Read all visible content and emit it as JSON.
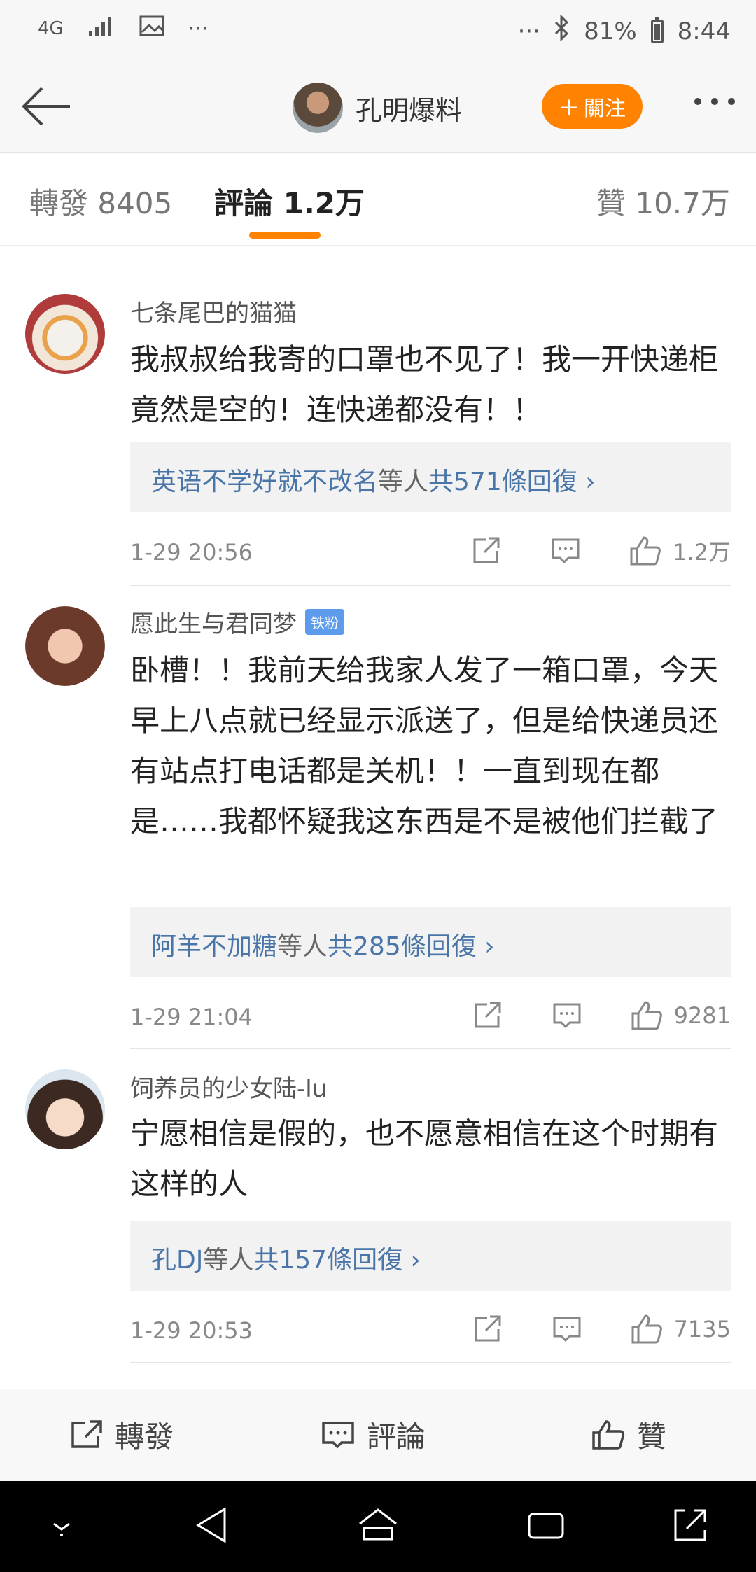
{
  "status_bar": {
    "network": "4G",
    "dots_left": "···",
    "dots_right": "···",
    "battery": "81%",
    "time": "8:44"
  },
  "header": {
    "account_name": "孔明爆料",
    "follow_label": "關注"
  },
  "tabs": [
    {
      "label": "轉發 8405"
    },
    {
      "label": "評論 1.2万"
    },
    {
      "label": "贊 10.7万"
    }
  ],
  "comments": [
    {
      "username": "七条尾巴的猫猫",
      "badge": "",
      "text": "我叔叔给我寄的口罩也不见了！我一开快递柜竟然是空的！连快递都没有！！",
      "reply_user": "英语不学好就不改名",
      "reply_mid": "等人",
      "reply_count": "共571條回復 ›",
      "time": "1-29 20:56",
      "likes": "1.2万"
    },
    {
      "username": "愿此生与君同梦",
      "badge": "铁粉",
      "text": "卧槽！！我前天给我家人发了一箱口罩，今天早上八点就已经显示派送了，但是给快递员还有站点打电话都是关机！！一直到现在都是……我都怀疑我这东西是不是被他们拦截了",
      "reply_user": "阿羊不加糖",
      "reply_mid": "等人",
      "reply_count": "共285條回復 ›",
      "time": "1-29 21:04",
      "likes": "9281"
    },
    {
      "username": "饲养员的少女陆-lu",
      "badge": "",
      "text": "宁愿相信是假的，也不愿意相信在这个时期有这样的人",
      "reply_user": "孔DJ",
      "reply_mid": "等人",
      "reply_count": "共157條回復 ›",
      "time": "1-29 20:53",
      "likes": "7135"
    }
  ],
  "actions": {
    "repost": "轉發",
    "comment": "評論",
    "like": "贊"
  },
  "icons": {
    "back": "back-arrow-icon",
    "more": "more-dots-icon",
    "share": "share-icon",
    "comment": "comment-icon",
    "like": "thumbs-up-icon"
  },
  "colors": {
    "accent": "#ff8200",
    "link": "#4a75a8"
  }
}
